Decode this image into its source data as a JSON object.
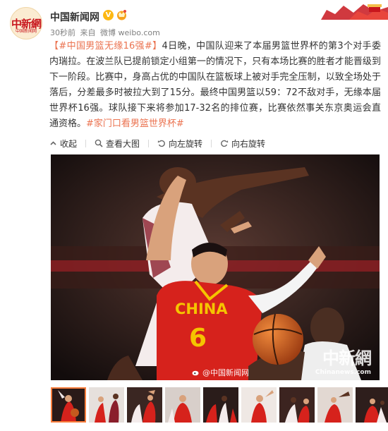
{
  "author": {
    "avatar_logo": "中新網",
    "avatar_caption": "中国新闻网",
    "name": "中国新闻网",
    "verified_mark": "V"
  },
  "meta": {
    "time": "30秒前",
    "source_prefix": "来自",
    "source": "微博 weibo.com"
  },
  "post": {
    "topic_open": "【",
    "topic": "#中国男篮无缘16强#",
    "topic_close": "】",
    "body": "4日晚，中国队迎来了本届男篮世界杯的第3个对手委内瑞拉。在波兰队已提前锁定小组第一的情况下，只有本场比赛的胜者才能晋级到下一阶段。比赛中，身高占优的中国队在篮板球上被对手完全压制，以致全场处于落后，分差最多时被拉大到了15分。最终中国男篮以59：72不敌对手，无缘本届世界杯16强。球队接下来将参加17-32名的排位赛，比赛依然事关东京奥运会直通资格。",
    "trailing_topic": "#家门口看男篮世界杯#"
  },
  "actions": [
    {
      "label": "收起",
      "icon": "collapse-icon"
    },
    {
      "label": "查看大图",
      "icon": "magnify-icon"
    },
    {
      "label": "向左旋转",
      "icon": "rotate-left-icon"
    },
    {
      "label": "向右旋转",
      "icon": "rotate-right-icon"
    }
  ],
  "photo": {
    "jersey_text": "CHINA",
    "jersey_number": "6",
    "weibo_watermark": "@中国新闻网",
    "logo_watermark": "中新網",
    "site_watermark": "Chinanews.com"
  },
  "thumbnails": {
    "count": 9,
    "active_index": 0
  },
  "colors": {
    "accent": "#eb7350",
    "verified": "#fdb813",
    "thumb_active": "#fa7d3c",
    "china_red": "#c8161d"
  }
}
